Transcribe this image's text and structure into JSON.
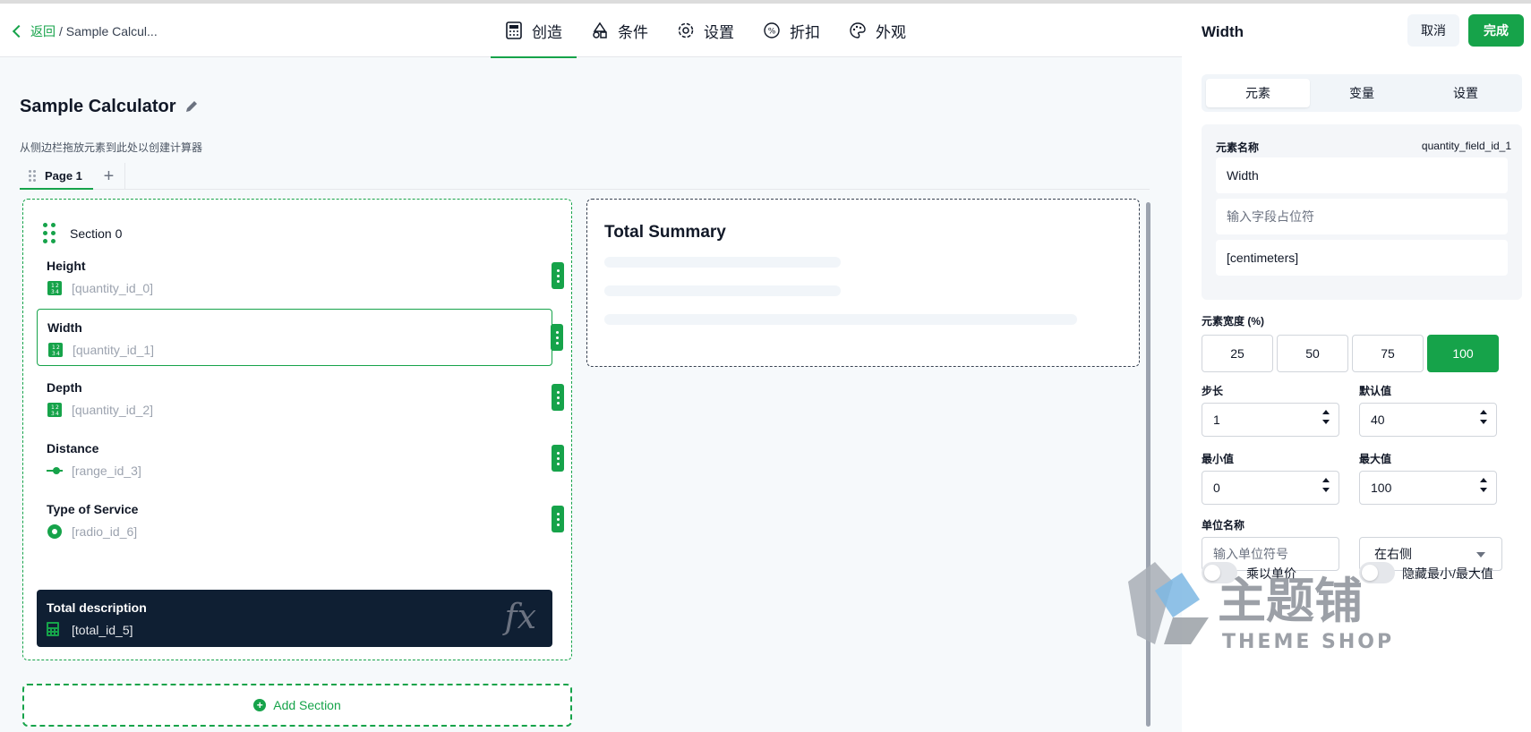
{
  "header": {
    "back_label": "返回",
    "breadcrumb": "/ Sample Calcul...",
    "tabs": [
      {
        "label": "创造",
        "icon": "calculator-icon"
      },
      {
        "label": "条件",
        "icon": "shapes-icon"
      },
      {
        "label": "设置",
        "icon": "gear-icon"
      },
      {
        "label": "折扣",
        "icon": "percent-icon"
      },
      {
        "label": "外观",
        "icon": "palette-icon"
      }
    ]
  },
  "canvas": {
    "title": "Sample Calculator",
    "subtitle": "从侧边栏拖放元素到此处以创建计算器",
    "page_tab": "Page 1",
    "add_page": "+",
    "section": {
      "name": "Section 0",
      "fields": [
        {
          "name": "Height",
          "id": "[quantity_id_0]",
          "icon": "quantity-icon"
        },
        {
          "name": "Width",
          "id": "[quantity_id_1]",
          "icon": "quantity-icon"
        },
        {
          "name": "Depth",
          "id": "[quantity_id_2]",
          "icon": "quantity-icon"
        },
        {
          "name": "Distance",
          "id": "[range_id_3]",
          "icon": "range-icon"
        },
        {
          "name": "Type of Service",
          "id": "[radio_id_6]",
          "icon": "radio-icon"
        }
      ],
      "total": {
        "name": "Total description",
        "id": "[total_id_5]",
        "icon": "calculator-icon",
        "badge": "fx"
      }
    },
    "add_section": "Add Section",
    "summary_title": "Total Summary"
  },
  "panel": {
    "title": "Width",
    "cancel": "取消",
    "done": "完成",
    "tabs": [
      "元素",
      "变量",
      "设置"
    ],
    "element_name_label": "元素名称",
    "element_id": "quantity_field_id_1",
    "name_value": "Width",
    "placeholder_hint": "输入字段占位符",
    "description_value": "[centimeters]",
    "width_label": "元素宽度 (%)",
    "width_options": [
      "25",
      "50",
      "75",
      "100"
    ],
    "width_selected": "100",
    "step_label": "步长",
    "step_value": "1",
    "default_label": "默认值",
    "default_value": "40",
    "min_label": "最小值",
    "min_value": "0",
    "max_label": "最大值",
    "max_value": "100",
    "unit_label": "单位名称",
    "unit_placeholder": "输入单位符号",
    "unit_position": "在右侧",
    "toggle_multiply": "乘以单价",
    "toggle_hide": "隐藏最小/最大值"
  },
  "watermark": {
    "cn": "主题铺",
    "en": "THEME SHOP"
  },
  "colors": {
    "accent": "#16a34a",
    "dark": "#0f1f33"
  }
}
